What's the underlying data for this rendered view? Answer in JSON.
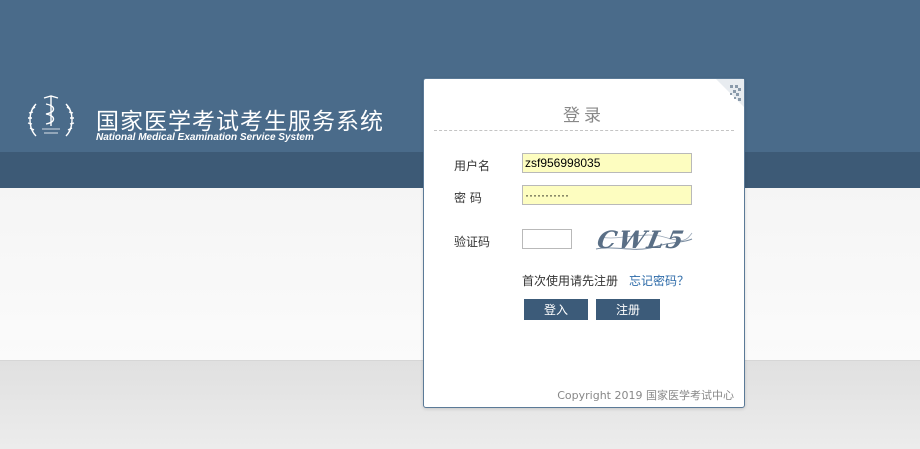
{
  "brand": {
    "title": "国家医学考试考生服务系统",
    "subtitle": "National Medical Examination Service System"
  },
  "login": {
    "title": "登录",
    "username_label": "用户名",
    "username_value": "zsf956998035",
    "password_label": "密 码",
    "password_value": "···········",
    "captcha_label": "验证码",
    "captcha_value": "",
    "captcha_text": "CWL5",
    "first_use_link": "首次使用请先注册",
    "forgot_link": "忘记密码？",
    "login_button": "登入",
    "register_button": "注册"
  },
  "footer": {
    "copyright": "Copyright 2019 国家医学考试中心"
  },
  "colors": {
    "header": "#4a6b8a",
    "header_strip": "#3d5a76",
    "button": "#3c5b79",
    "input_highlight": "#fdfdc0",
    "link": "#2c6aa8"
  }
}
